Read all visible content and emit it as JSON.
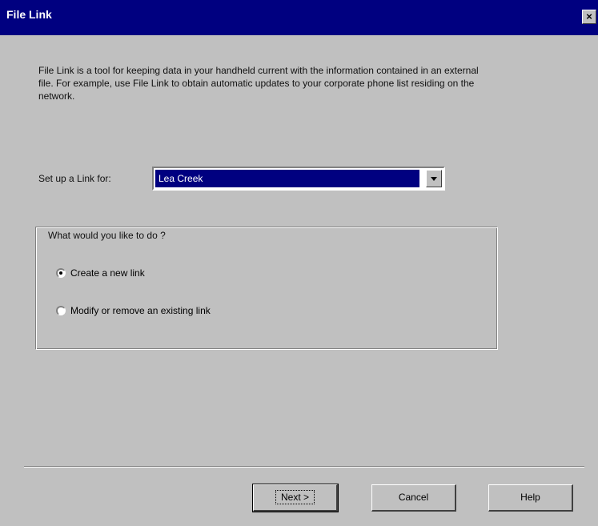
{
  "window": {
    "title": "File Link",
    "close_label": "×"
  },
  "intro": {
    "text": "File Link is a tool for keeping data in your handheld current with the information contained in an external file. For example,  use File Link to obtain automatic updates to your corporate phone list residing on the network."
  },
  "link_setup": {
    "label": "Set up a Link for:",
    "selected_user": "Lea Creek"
  },
  "action_group": {
    "title": "What would you like to do ?",
    "options": [
      {
        "label": "Create a new link",
        "checked": true
      },
      {
        "label": "Modify or remove an existing link",
        "checked": false
      }
    ]
  },
  "buttons": {
    "next": "Next >",
    "cancel": "Cancel",
    "help": "Help"
  },
  "colors": {
    "title_bar": "#000080",
    "dialog_face": "#c0c0c0",
    "selection": "#000080"
  }
}
